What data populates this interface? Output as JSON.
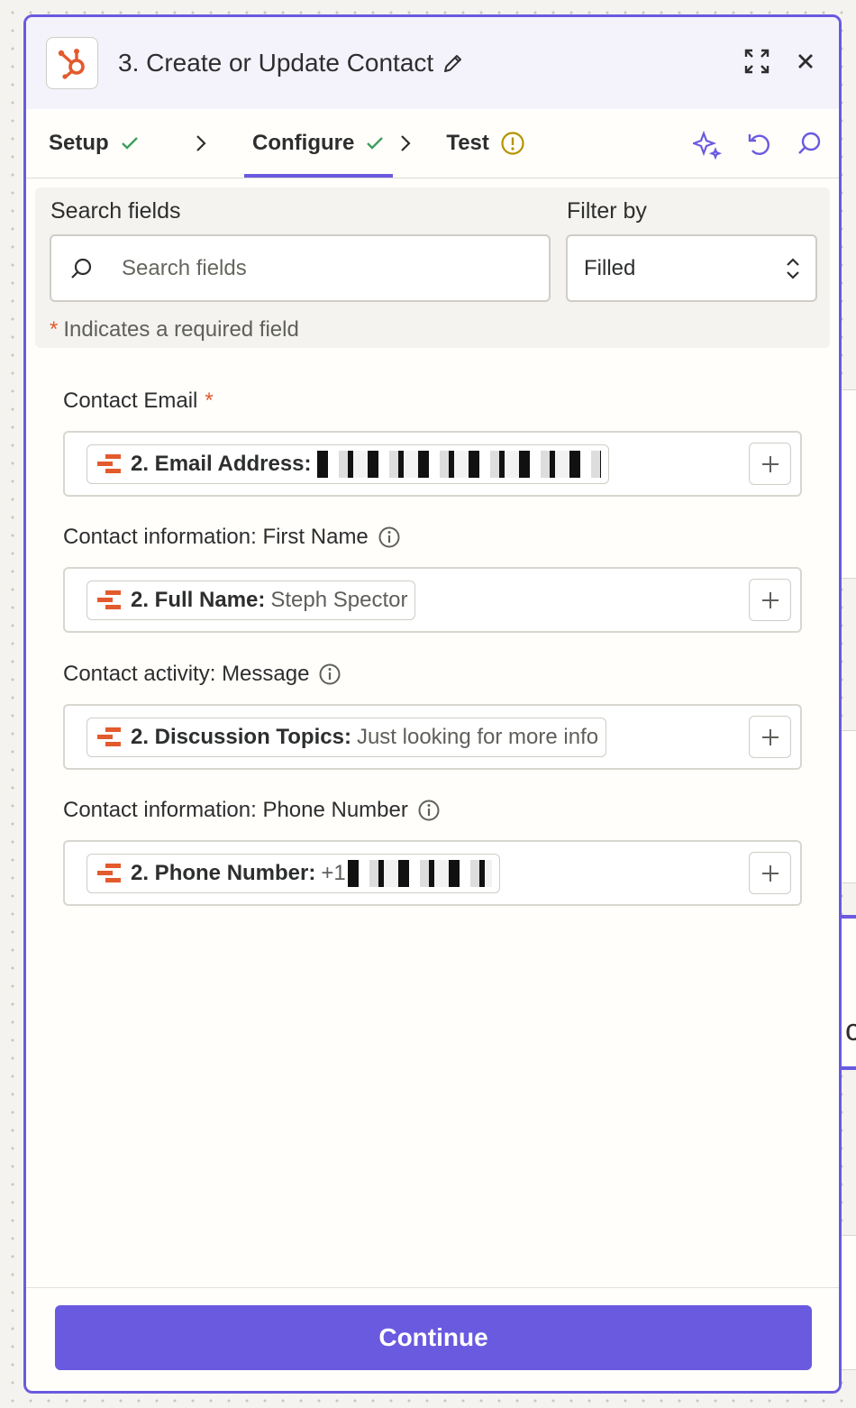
{
  "header": {
    "app_icon": "hubspot-icon",
    "title": "3. Create or Update Contact"
  },
  "tabs": [
    {
      "label": "Setup",
      "status": "complete"
    },
    {
      "label": "Configure",
      "status": "complete",
      "active": true
    },
    {
      "label": "Test",
      "status": "warning"
    }
  ],
  "filters": {
    "search_label": "Search fields",
    "search_placeholder": "Search fields",
    "filter_label": "Filter by",
    "filter_value": "Filled",
    "required_note": "Indicates a required field",
    "required_marker": "*"
  },
  "fields": [
    {
      "label": "Contact Email",
      "required": true,
      "pill_key": "2. Email Address:",
      "pill_value": ""
    },
    {
      "label": "Contact information: First Name",
      "info": true,
      "pill_key": "2. Full Name:",
      "pill_value": "Steph Spector"
    },
    {
      "label": "Contact activity: Message",
      "info": true,
      "pill_key": "2. Discussion Topics:",
      "pill_value": "Just looking for more info"
    },
    {
      "label": "Contact information: Phone Number",
      "info": true,
      "pill_key": "2. Phone Number:",
      "pill_value": "+1"
    }
  ],
  "footer": {
    "continue_label": "Continue"
  },
  "colors": {
    "accent": "#6a5ae0",
    "hubspot": "#e35a2c",
    "success": "#3e9f5c",
    "warning": "#b59300"
  }
}
